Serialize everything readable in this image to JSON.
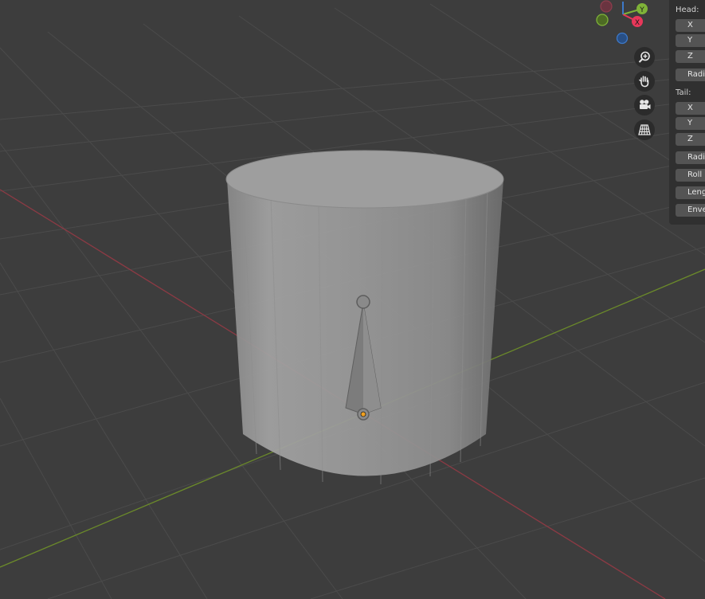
{
  "gizmo": {
    "y_label": "Y",
    "x_label": "X",
    "colors": {
      "x": "#e8375a",
      "y": "#7fb338",
      "z": "#3d79c9",
      "x_neg": "#8b3d4c"
    }
  },
  "nav_tools": [
    {
      "name": "zoom",
      "icon": "magnifier-plus-icon"
    },
    {
      "name": "pan",
      "icon": "hand-icon"
    },
    {
      "name": "camera",
      "icon": "camera-icon"
    },
    {
      "name": "ortho",
      "icon": "grid-perspective-icon"
    }
  ],
  "properties": {
    "head_label": "Head:",
    "head": {
      "x": "X",
      "y": "Y",
      "z": "Z",
      "radius": "Radius"
    },
    "tail_label": "Tail:",
    "tail": {
      "x": "X",
      "y": "Y",
      "z": "Z",
      "radius": "Radius"
    },
    "roll": "Roll",
    "length": "Length",
    "envelope": "Envelope"
  },
  "scene": {
    "colors": {
      "background": "#3d3d3d",
      "grid": "#4a4a4a",
      "x_axis": "#8c3a44",
      "y_axis": "#6b8a2a",
      "origin": "#f0a020"
    }
  }
}
